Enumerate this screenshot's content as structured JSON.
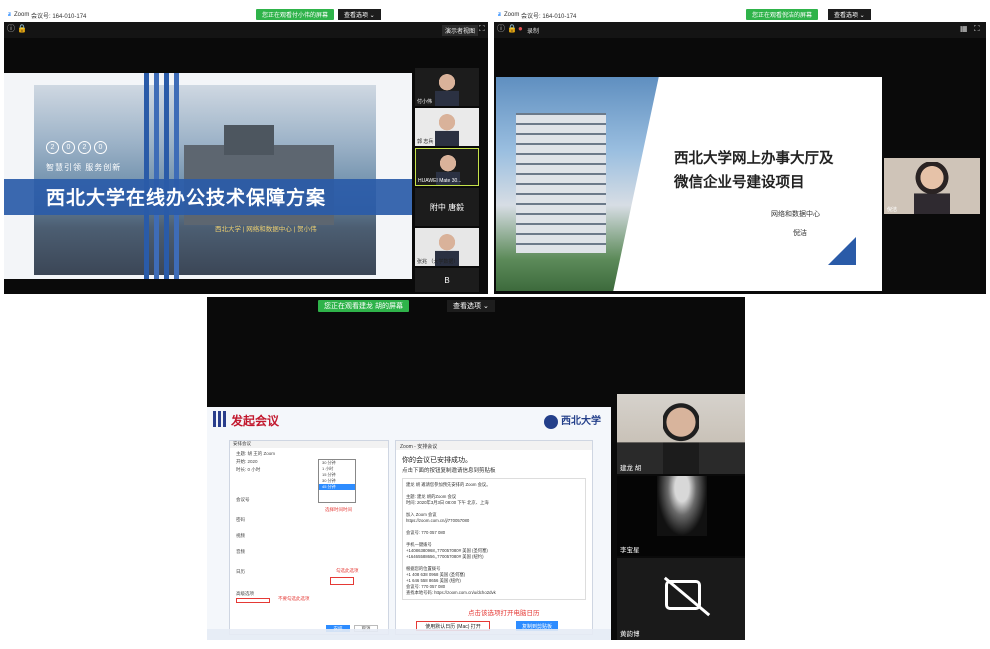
{
  "zoom_common": {
    "app": "Zoom",
    "meeting_id_label": "会议号: 164-010-174",
    "view_options": "查看选项 ⌄"
  },
  "shot_a": {
    "viewing_banner": "您正在观看付小伟的屏幕",
    "present_btn": "演示者视图",
    "slide": {
      "year_digits": [
        "2",
        "0",
        "2",
        "0"
      ],
      "motto": "智慧引领  服务创新",
      "title": "西北大学在线办公技术保障方案",
      "org_line": "西北大学   |   网络和数据中心   |   贺小伟"
    },
    "participants": [
      {
        "label": "付小伟"
      },
      {
        "label": "郭 志兵"
      },
      {
        "label": "HUAWEI Mate 30..."
      },
      {
        "label": "附中 唐毅"
      },
      {
        "label": "张兆 （大学数据）"
      },
      {
        "label": "B"
      }
    ]
  },
  "shot_b": {
    "viewing_banner": "您正在观看倪洁的屏幕",
    "record_label": "录制",
    "slide": {
      "title_line1": "西北大学网上办事大厅及",
      "title_line2": "微信企业号建设项目",
      "dept": "网络和数据中心",
      "presenter": "倪洁"
    },
    "participant": {
      "label": "倪洁"
    }
  },
  "shot_c": {
    "viewing_banner": "您正在观看建龙 胡的屏幕",
    "view_options": "查看选项 ⌄",
    "slide": {
      "heading": "发起会议",
      "logo_text": "西北大学",
      "left_panel": {
        "title": "安排会议",
        "rows": [
          "主题: 胡 王的 Zoom",
          "开始: 2020",
          "时长: 0 小时",
          "会议号",
          "密码",
          "视频",
          "音频",
          "日历",
          "高级选项"
        ],
        "dropdown_options": [
          "30 分钟",
          "1 小时",
          "15 分钟",
          "30 分钟",
          "45 分钟"
        ],
        "note_duration": "选择时间时间",
        "note_calendar": "勾选此选项",
        "note_advanced": "不要勾选此选项",
        "save_btn": "安排",
        "cancel_btn": "取消"
      },
      "right_panel": {
        "window_title": "Zoom - 安排会议",
        "heading": "你的会议已安排成功。",
        "subheading": "点击下面的按钮复制邀请信息到剪贴板",
        "invite_lines": [
          "建龙 胡 邀请您参加预先安排的 Zoom 会议。",
          "",
          "主题: 建龙 胡的Zoom 会议",
          "时间: 2020年3月3日 08:00 下午 北京、上海",
          "",
          "加入 Zoom 会议",
          "https://zoom.com.cn/j/770057080",
          "",
          "会议号: 770 057 080",
          "",
          "手机一键拨号",
          "+14086380968,,770057080# 美国 (圣何塞)",
          "+16465588656,,770057080# 美国 (纽约)",
          "",
          "根据您的位置拨号",
          "    +1 408 638 0968 美国 (圣何塞)",
          "    +1 646 558 8656 美国 (纽约)",
          "会议号: 770 057 080",
          "查找本地号码: https://zoom.com.cn/u/dcho2dvk"
        ],
        "note_open": "点击该选项打开电脑日历",
        "open_calendar_btn": "使用默认日历 (Mac) 打开",
        "copy_btn": "复制到剪贴板"
      }
    },
    "participants": [
      {
        "label": "建龙 胡"
      },
      {
        "label": "李宝星"
      },
      {
        "label": "黄韵博"
      }
    ]
  }
}
